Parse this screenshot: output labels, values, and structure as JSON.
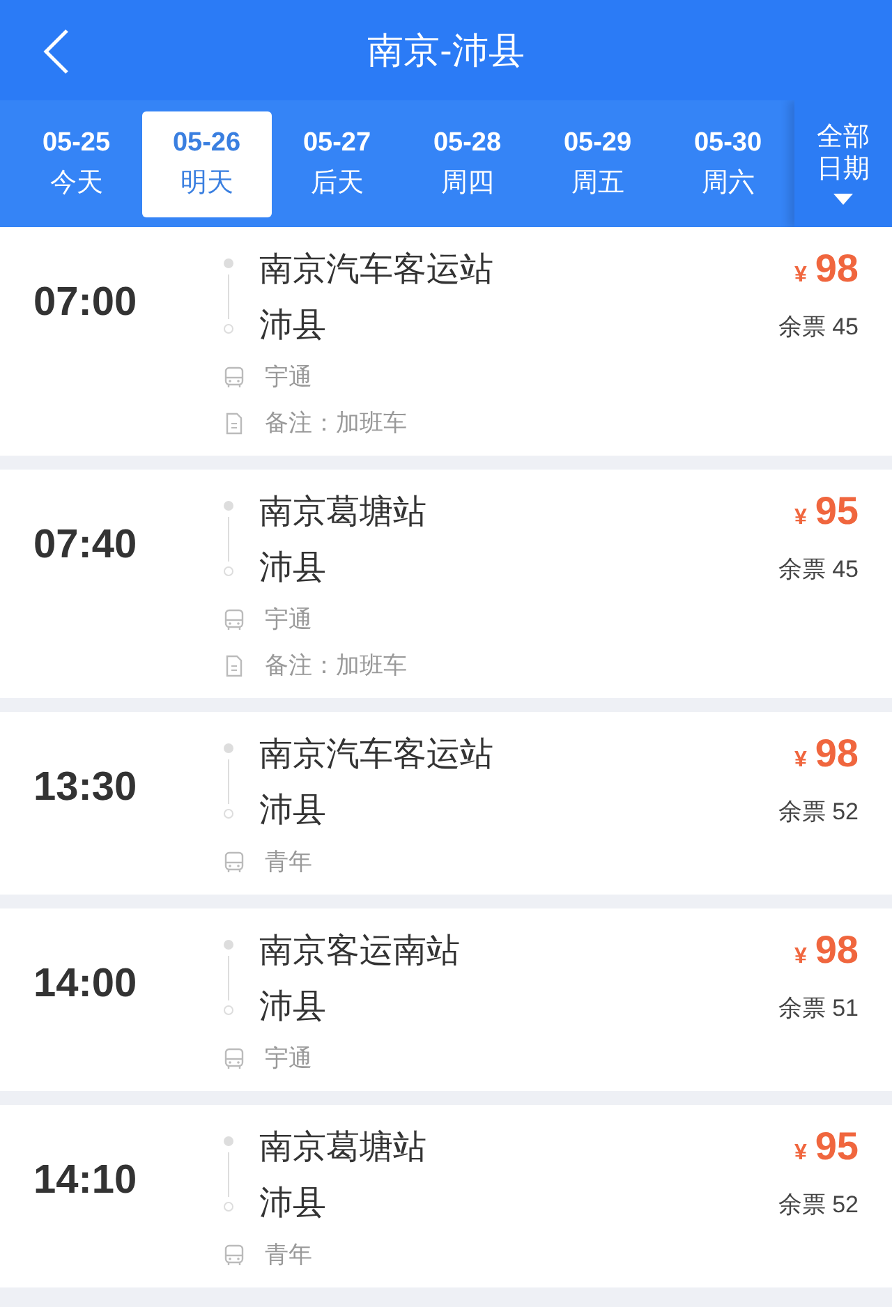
{
  "header": {
    "title": "南京-沛县"
  },
  "dates": [
    {
      "date": "05-25",
      "day": "今天",
      "selected": false
    },
    {
      "date": "05-26",
      "day": "明天",
      "selected": true
    },
    {
      "date": "05-27",
      "day": "后天",
      "selected": false
    },
    {
      "date": "05-28",
      "day": "周四",
      "selected": false
    },
    {
      "date": "05-29",
      "day": "周五",
      "selected": false
    },
    {
      "date": "05-30",
      "day": "周六",
      "selected": false
    }
  ],
  "all_dates": {
    "label": "全部日期"
  },
  "trips": [
    {
      "time": "07:00",
      "from": "南京汽车客运站",
      "to": "沛县",
      "operator": "宇通",
      "note": "备注：加班车",
      "currency": "¥",
      "price": "98",
      "remaining": "余票 45"
    },
    {
      "time": "07:40",
      "from": "南京葛塘站",
      "to": "沛县",
      "operator": "宇通",
      "note": "备注：加班车",
      "currency": "¥",
      "price": "95",
      "remaining": "余票 45"
    },
    {
      "time": "13:30",
      "from": "南京汽车客运站",
      "to": "沛县",
      "operator": "青年",
      "currency": "¥",
      "price": "98",
      "remaining": "余票 52"
    },
    {
      "time": "14:00",
      "from": "南京客运南站",
      "to": "沛县",
      "operator": "宇通",
      "currency": "¥",
      "price": "98",
      "remaining": "余票 51"
    },
    {
      "time": "14:10",
      "from": "南京葛塘站",
      "to": "沛县",
      "operator": "青年",
      "currency": "¥",
      "price": "95",
      "remaining": "余票 52"
    }
  ]
}
